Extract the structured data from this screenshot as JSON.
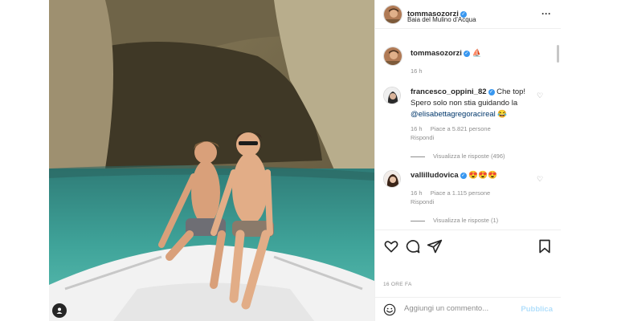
{
  "post": {
    "author": "tommasozorzi",
    "location": "Baia del Mulino d'Acqua",
    "caption_author": "tommasozorzi",
    "caption_emoji": "⛵",
    "caption_time": "16 h",
    "timestamp": "16 ORE FA",
    "more_icon": "more-horizontal-icon"
  },
  "comments": [
    {
      "author": "francesco_oppini_82",
      "text_before": "Che top! Spero solo non stia guidando la ",
      "mention": "@elisabettagregoracireal",
      "text_after": " 😂",
      "time": "16 h",
      "likes": "Piace a 5.821 persone",
      "reply": "Rispondi",
      "view_replies": "Visualizza le risposte (496)"
    },
    {
      "author": "vallilludovica",
      "text_before": "😍😍😍",
      "mention": "",
      "text_after": "",
      "time": "16 h",
      "likes": "Piace a 1.115 persone",
      "reply": "Rispondi",
      "view_replies": "Visualizza le risposte (1)"
    }
  ],
  "actions": [
    "heart-icon",
    "comment-icon",
    "share-icon",
    "bookmark-icon"
  ],
  "add_comment": {
    "placeholder": "Aggiungi un commento...",
    "publish": "Pubblica"
  }
}
